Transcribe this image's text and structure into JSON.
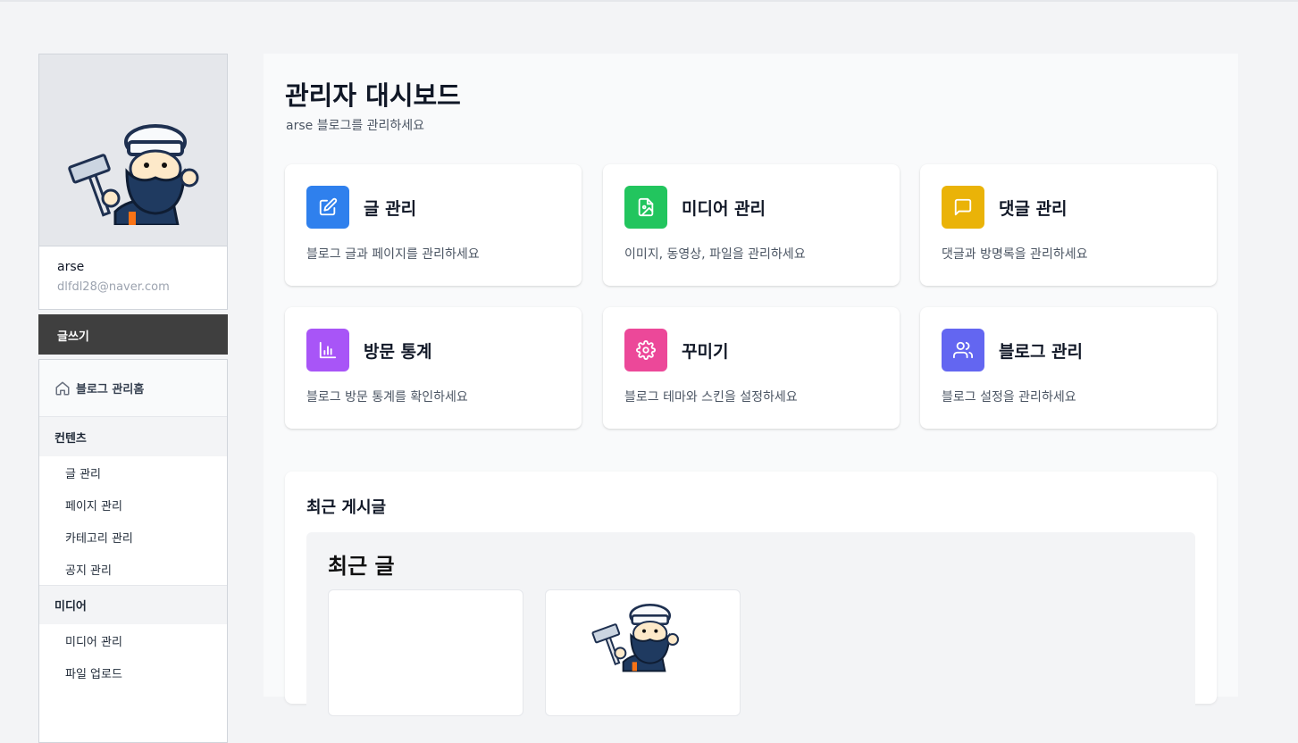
{
  "profile": {
    "name": "arse",
    "email": "dlfdl28@naver.com"
  },
  "sidebar": {
    "write_label": "글쓰기",
    "home_label": "블로그 관리홈",
    "sections": [
      {
        "title": "컨텐츠",
        "items": [
          "글 관리",
          "페이지 관리",
          "카테고리 관리",
          "공지 관리"
        ]
      },
      {
        "title": "미디어",
        "items": [
          "미디어 관리",
          "파일 업로드"
        ]
      }
    ]
  },
  "main": {
    "title": "관리자 대시보드",
    "subtitle": "arse 블로그를 관리하세요",
    "cards": [
      {
        "title": "글 관리",
        "desc": "블로그 글과 페이지를 관리하세요",
        "icon": "edit-icon",
        "color": "#2f80ed"
      },
      {
        "title": "미디어 관리",
        "desc": "이미지, 동영상, 파일을 관리하세요",
        "icon": "image-file-icon",
        "color": "#22c55e"
      },
      {
        "title": "댓글 관리",
        "desc": "댓글과 방명록을 관리하세요",
        "icon": "comment-icon",
        "color": "#eab308"
      },
      {
        "title": "방문 통계",
        "desc": "블로그 방문 통계를 확인하세요",
        "icon": "bar-chart-icon",
        "color": "#a855f7"
      },
      {
        "title": "꾸미기",
        "desc": "블로그 테마와 스킨을 설정하세요",
        "icon": "gear-icon",
        "color": "#ec4899"
      },
      {
        "title": "블로그 관리",
        "desc": "블로그 설정을 관리하세요",
        "icon": "users-icon",
        "color": "#6366f1"
      }
    ],
    "recent": {
      "title": "최근 게시글",
      "inner_title": "최근 글"
    }
  }
}
